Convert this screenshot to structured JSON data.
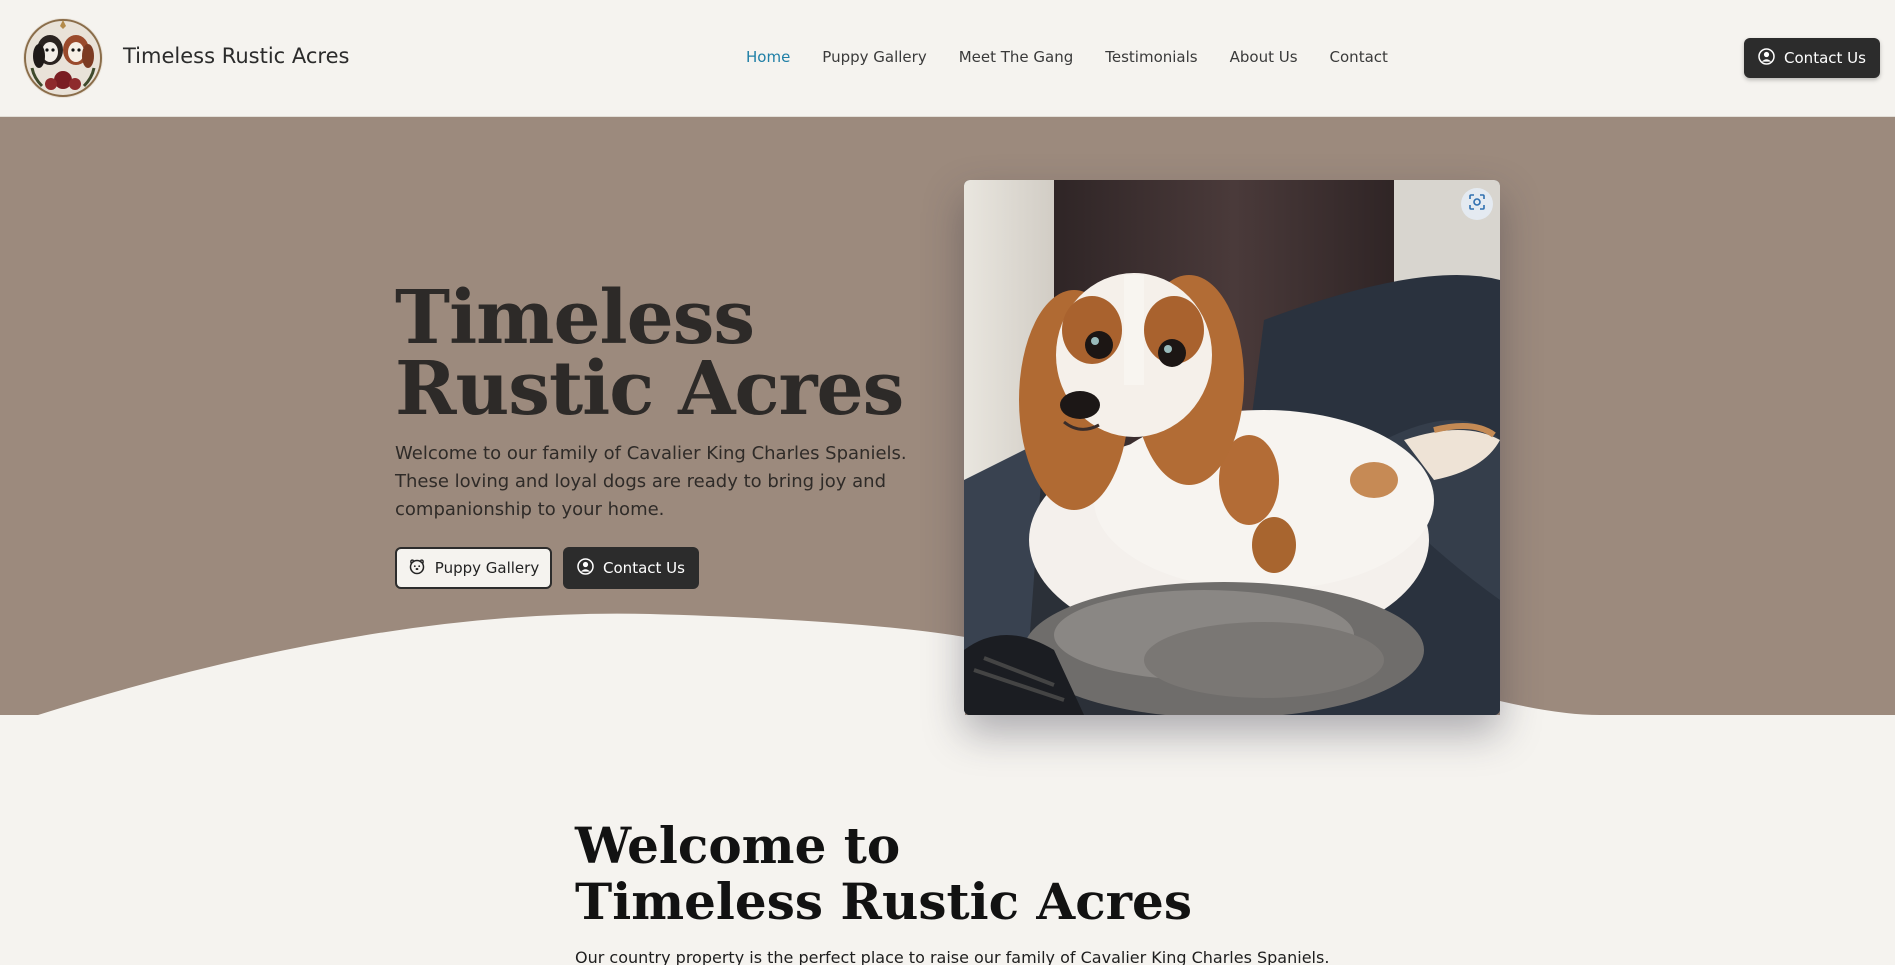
{
  "header": {
    "site_name": "Timeless Rustic Acres",
    "logo_icon": "cavalier-spaniels-logo-icon",
    "cta_label": "Contact Us"
  },
  "nav": {
    "items": [
      {
        "label": "Home",
        "active": true
      },
      {
        "label": "Puppy Gallery",
        "active": false
      },
      {
        "label": "Meet The Gang",
        "active": false
      },
      {
        "label": "Testimonials",
        "active": false
      },
      {
        "label": "About Us",
        "active": false
      },
      {
        "label": "Contact",
        "active": false
      }
    ],
    "active_color": "#1f7fa6"
  },
  "hero": {
    "title_line1": "Timeless",
    "title_line2": "Rustic Acres",
    "description": "Welcome to our family of Cavalier King Charles Spaniels. These loving and loyal dogs are ready to bring joy and companionship to your home.",
    "gallery_button": "Puppy Gallery",
    "contact_button": "Contact Us",
    "background_color": "#9c8a7d"
  },
  "welcome": {
    "title_line1": "Welcome to",
    "title_line2": "Timeless Rustic Acres",
    "text": "Our country property is the perfect place to raise our family of Cavalier King Charles Spaniels."
  }
}
